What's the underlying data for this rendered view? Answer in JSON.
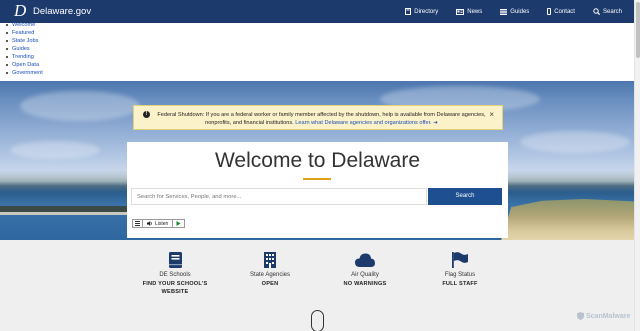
{
  "header": {
    "brand_letter": "D",
    "brand_small": "Delaware",
    "brand_name": "Delaware.gov",
    "nav": [
      {
        "label": "Directory",
        "icon": "book-icon"
      },
      {
        "label": "News",
        "icon": "newspaper-icon"
      },
      {
        "label": "Guides",
        "icon": "list-icon"
      },
      {
        "label": "Contact",
        "icon": "phone-icon"
      },
      {
        "label": "Search",
        "icon": "search-icon"
      }
    ]
  },
  "quick_links": [
    "Welcome",
    "Featured",
    "State Jobs",
    "Guides",
    "Trending",
    "Open Data",
    "Government"
  ],
  "alert": {
    "text": "Federal Shutdown: If you are a federal worker or family member affected by the shutdown, help is available from Delaware agencies, nonprofits, and financial institutions.",
    "link": "Learn what Delaware agencies and organizations offer. ➔",
    "close": "×"
  },
  "welcome": {
    "title": "Welcome to Delaware",
    "search_placeholder": "Search for Services, People, and more...",
    "search_button": "Search",
    "listen": "Listen"
  },
  "stats": [
    {
      "label": "DE Schools",
      "value": "FIND YOUR SCHOOL'S WEBSITE",
      "icon": "school-book-icon"
    },
    {
      "label": "State Agencies",
      "value": "OPEN",
      "icon": "building-icon"
    },
    {
      "label": "Air Quality",
      "value": "NO WARNINGS",
      "icon": "cloud-icon"
    },
    {
      "label": "Flag Status",
      "value": "FULL STAFF",
      "icon": "flag-icon"
    }
  ],
  "watermark": "ScanMalware",
  "colors": {
    "nav_bg": "#1d3a6d",
    "search_button": "#1d4f91",
    "alert_bg": "#fbf2c9",
    "accent": "#e0a21a",
    "link": "#1a4fb5",
    "icon": "#1d3a6d"
  }
}
